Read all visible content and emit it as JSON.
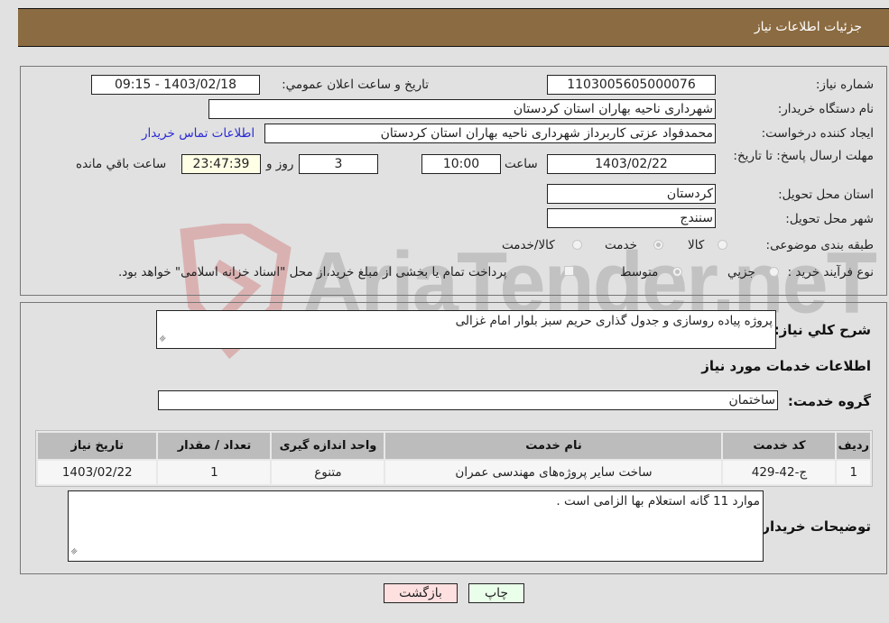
{
  "header": {
    "title": "جزئیات اطلاعات نیاز"
  },
  "form": {
    "need_number": {
      "label": "شماره نیاز:",
      "value": "1103005605000076"
    },
    "announce_datetime": {
      "label": "تاريخ و ساعت اعلان عمومي:",
      "value": "1403/02/18 - 09:15"
    },
    "buyer_org": {
      "label": "نام دستگاه خریدار:",
      "value": "شهرداری ناحیه بهاران استان کردستان"
    },
    "requester": {
      "label": "ایجاد کننده درخواست:",
      "value": "محمدفواد عزتی کاربرداز شهرداری ناحیه بهاران استان کردستان"
    },
    "buyer_contact_link": "اطلاعات تماس خریدار",
    "deadline": {
      "label": "مهلت ارسال پاسخ: تا تاریخ:",
      "date": "1403/02/22",
      "time_label": "ساعت",
      "time": "10:00",
      "days": "3",
      "days_label": "روز و",
      "remaining": "23:47:39",
      "remaining_label": "ساعت باقي مانده"
    },
    "delivery_province": {
      "label": "استان محل تحویل:",
      "value": "کردستان"
    },
    "delivery_city": {
      "label": "شهر محل تحویل:",
      "value": "سنندج"
    },
    "category": {
      "label": "طبقه بندی موضوعی:",
      "options": [
        {
          "label": "کالا",
          "checked": false
        },
        {
          "label": "خدمت",
          "checked": true
        },
        {
          "label": "کالا/خدمت",
          "checked": false
        }
      ]
    },
    "purchase_type": {
      "label": "نوع فرآیند خرید :",
      "options": [
        {
          "label": "جزيي",
          "checked": false
        },
        {
          "label": "متوسط",
          "checked": true
        }
      ],
      "treasury_note": "پرداخت تمام یا بخشی از مبلغ خرید،از محل \"اسناد خزانه اسلامی\" خواهد بود."
    }
  },
  "description": {
    "label": "شرح کلي نياز:",
    "value": "پروژه پیاده روسازی و جدول گذاری حریم سبز بلوار امام غزالی"
  },
  "services": {
    "section_title": "اطلاعات خدمات مورد نياز",
    "group_label": "گروه خدمت:",
    "group_value": "ساختمان",
    "table": {
      "headers": [
        "ردیف",
        "کد خدمت",
        "نام خدمت",
        "واحد اندازه گیری",
        "تعداد / مقدار",
        "تاریخ نیاز"
      ],
      "rows": [
        [
          "1",
          "ج-42-429",
          "ساخت سایر پروژه‌های مهندسی عمران",
          "متنوع",
          "1",
          "1403/02/22"
        ]
      ]
    }
  },
  "buyer_notes": {
    "label": "توضیحات خریدار:",
    "value": "موارد 11 گانه استعلام بها الزامی است ."
  },
  "buttons": {
    "print": "چاپ",
    "back": "بازگشت"
  },
  "watermark": {
    "text": "AriaTender.neT"
  },
  "colors": {
    "header": "#8b6b41",
    "print_button": "#eaffea",
    "back_button": "#ffe0e0",
    "link": "#2b2bd6"
  }
}
